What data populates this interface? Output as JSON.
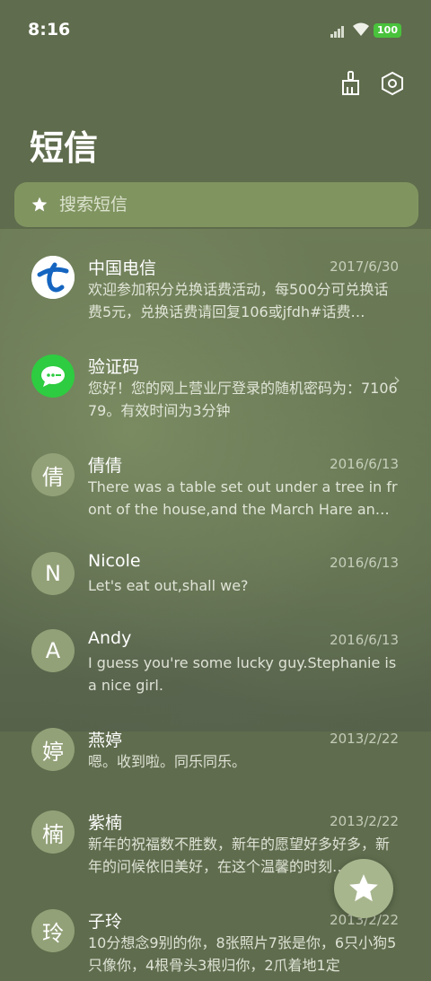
{
  "status": {
    "time": "8:16",
    "battery": "100"
  },
  "toolbar": {
    "clean_icon": "broom-icon",
    "settings_icon": "settings-hex-icon"
  },
  "page": {
    "title": "短信"
  },
  "search": {
    "placeholder": "搜索短信"
  },
  "messages": [
    {
      "name": "中国电信",
      "date": "2017/6/30",
      "snippet": "欢迎参加积分兑换话费活动，每500分可兑换话费5元，兑换话费请回复106或jfdh#话费…",
      "avatar_icon": "china-telecom-logo"
    },
    {
      "name": "验证码",
      "date": "",
      "snippet": "您好！您的网上营业厅登录的随机密码为：710679。有效时间为3分钟",
      "avatar_icon": "chat-bubble-icon"
    },
    {
      "name": "倩倩",
      "date": "2016/6/13",
      "snippet": "There was a table set out under a tree in front of the house,and the March Hare an…",
      "avatar": "倩"
    },
    {
      "name": "Nicole",
      "date": "2016/6/13",
      "snippet": "Let's eat out,shall we?",
      "avatar": "N"
    },
    {
      "name": "Andy",
      "date": "2016/6/13",
      "snippet": "I guess you're some lucky guy.Stephanie is a nice girl.",
      "avatar": "A"
    },
    {
      "name": "燕婷",
      "date": "2013/2/22",
      "snippet": "嗯。收到啦。同乐同乐。",
      "avatar": "婷"
    },
    {
      "name": "紫楠",
      "date": "2013/2/22",
      "snippet": "新年的祝福数不胜数，新年的愿望好多好多，新年的问候依旧美好，在这个温馨的时刻…",
      "avatar": "楠"
    },
    {
      "name": "子玲",
      "date": "2013/2/22",
      "snippet": "10分想念9别的你，8张照片7张是你，6只小狗5只像你，4根骨头3根归你，2爪着地1定",
      "avatar": "玲"
    }
  ],
  "colors": {
    "accent": "#a8b68e",
    "background": "#5f6c4d",
    "telecom_blue": "#1565c0",
    "chat_green": "#2ecc40"
  }
}
